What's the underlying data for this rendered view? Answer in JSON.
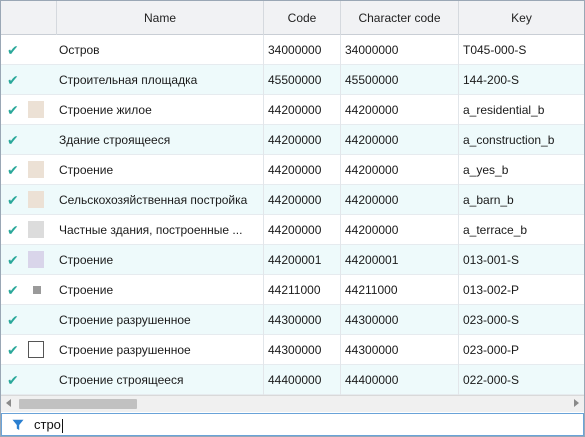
{
  "columns": {
    "name": "Name",
    "code": "Code",
    "character_code": "Character code",
    "key": "Key"
  },
  "rows": [
    {
      "checked": true,
      "swatch": "none",
      "swatch_color": "",
      "name": "Остров",
      "code": "34000000",
      "character_code": "34000000",
      "key": "T045-000-S",
      "alt": false
    },
    {
      "checked": true,
      "swatch": "none",
      "swatch_color": "",
      "name": "Строительная площадка",
      "code": "45500000",
      "character_code": "45500000",
      "key": "144-200-S",
      "alt": true
    },
    {
      "checked": true,
      "swatch": "fill",
      "swatch_color": "#ece1d5",
      "name": "Строение жилое",
      "code": "44200000",
      "character_code": "44200000",
      "key": "a_residential_b",
      "alt": false
    },
    {
      "checked": true,
      "swatch": "none",
      "swatch_color": "",
      "name": "Здание строящееся",
      "code": "44200000",
      "character_code": "44200000",
      "key": "a_construction_b",
      "alt": true
    },
    {
      "checked": true,
      "swatch": "fill",
      "swatch_color": "#ece1d5",
      "name": "Строение",
      "code": "44200000",
      "character_code": "44200000",
      "key": "a_yes_b",
      "alt": false
    },
    {
      "checked": true,
      "swatch": "fill",
      "swatch_color": "#ece1d5",
      "name": "Сельскохозяйственная постройка",
      "code": "44200000",
      "character_code": "44200000",
      "key": "a_barn_b",
      "alt": true
    },
    {
      "checked": true,
      "swatch": "fill",
      "swatch_color": "#dcdcdc",
      "name": "Частные здания, построенные ...",
      "code": "44200000",
      "character_code": "44200000",
      "key": "a_terrace_b",
      "alt": false
    },
    {
      "checked": true,
      "swatch": "fill",
      "swatch_color": "#d9d5ea",
      "name": "Строение",
      "code": "44200001",
      "character_code": "44200001",
      "key": "013-001-S",
      "alt": true
    },
    {
      "checked": true,
      "swatch": "small",
      "swatch_color": "#9a9a9a",
      "name": "Строение",
      "code": "44211000",
      "character_code": "44211000",
      "key": "013-002-P",
      "alt": false
    },
    {
      "checked": true,
      "swatch": "none",
      "swatch_color": "",
      "name": "Строение разрушенное",
      "code": "44300000",
      "character_code": "44300000",
      "key": "023-000-S",
      "alt": true
    },
    {
      "checked": true,
      "swatch": "outline",
      "swatch_color": "#ffffff",
      "name": "Строение разрушенное",
      "code": "44300000",
      "character_code": "44300000",
      "key": "023-000-P",
      "alt": false
    },
    {
      "checked": true,
      "swatch": "none",
      "swatch_color": "",
      "name": "Строение строящееся",
      "code": "44400000",
      "character_code": "44400000",
      "key": "022-000-S",
      "alt": true
    }
  ],
  "filter": {
    "value": "стро",
    "icon": "funnel-icon",
    "icon_color": "#2b7fd0"
  },
  "colors": {
    "check": "#2aa89a",
    "alt_row": "#eefafb"
  }
}
